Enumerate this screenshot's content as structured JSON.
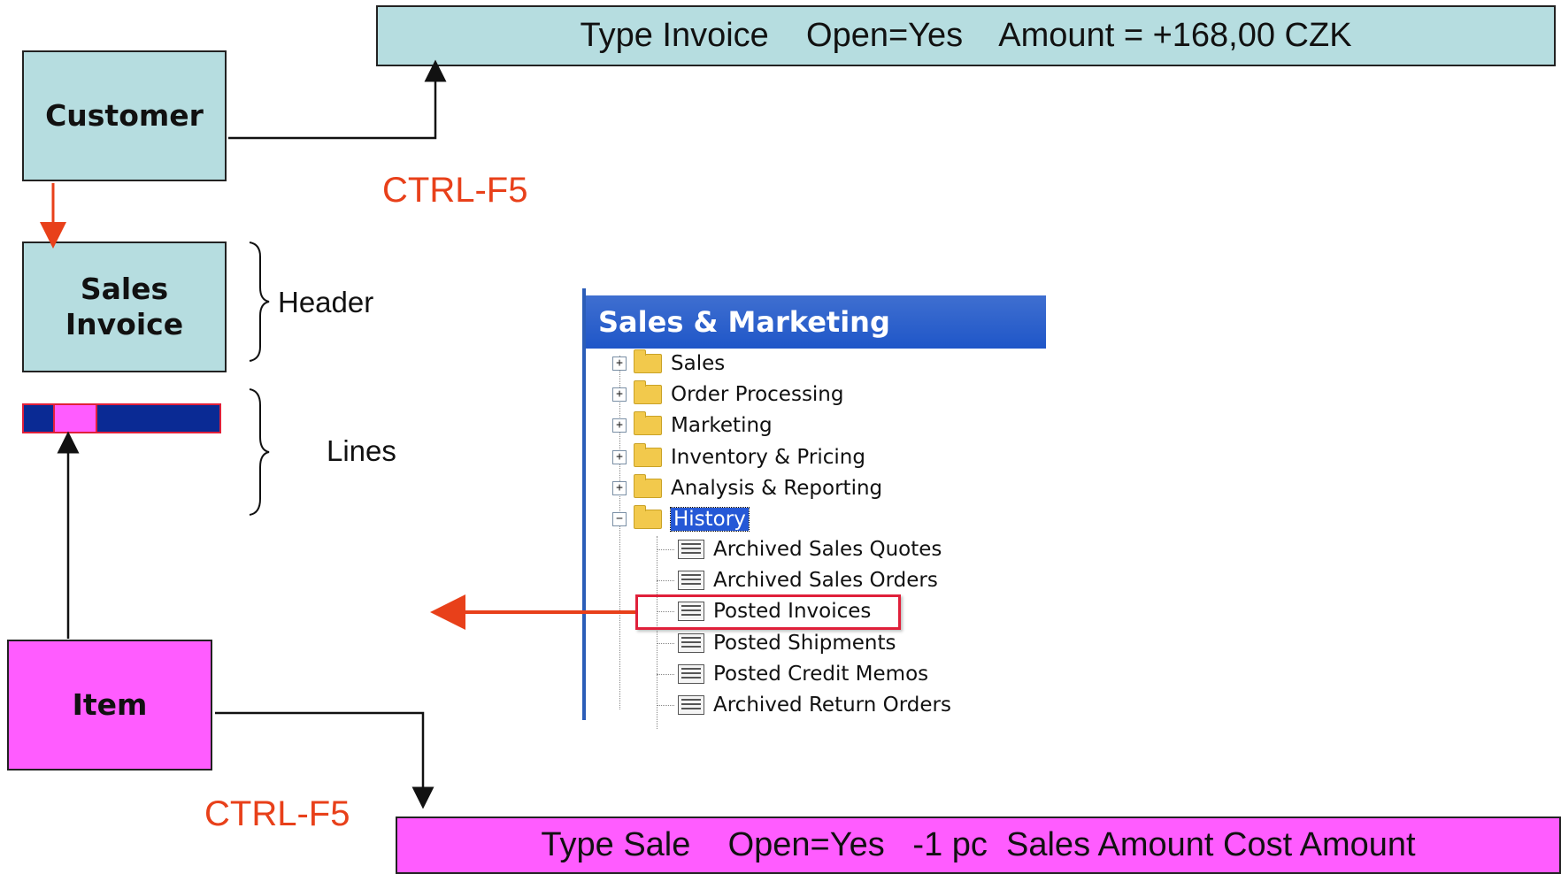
{
  "top_ledger": {
    "text": "Type Invoice    Open=Yes    Amount = +168,00 CZK"
  },
  "bottom_ledger": {
    "text": "Type Sale    Open=Yes   -1 pc  Sales Amount Cost Amount"
  },
  "boxes": {
    "customer": "Customer",
    "sales_invoice_line1": "Sales",
    "sales_invoice_line2": "Invoice",
    "item": "Item"
  },
  "shortcut_top": "CTRL-F5",
  "shortcut_bottom": "CTRL-F5",
  "brace_labels": {
    "header": "Header",
    "lines": "Lines"
  },
  "nav_pane": {
    "title": "Sales & Marketing",
    "folders": [
      "Sales",
      "Order Processing",
      "Marketing",
      "Inventory & Pricing",
      "Analysis & Reporting"
    ],
    "expanded_folder": "History",
    "history_items": [
      "Archived Sales Quotes",
      "Archived Sales Orders",
      "Posted Invoices",
      "Posted Shipments",
      "Posted Credit Memos",
      "Archived Return Orders"
    ],
    "highlighted_item": "Posted Invoices"
  },
  "colors": {
    "accent_arrow": "#e8401a",
    "teal_box": "#b6dde0",
    "magenta_box": "#ff5cff",
    "nav_header": "#2b5db8"
  }
}
